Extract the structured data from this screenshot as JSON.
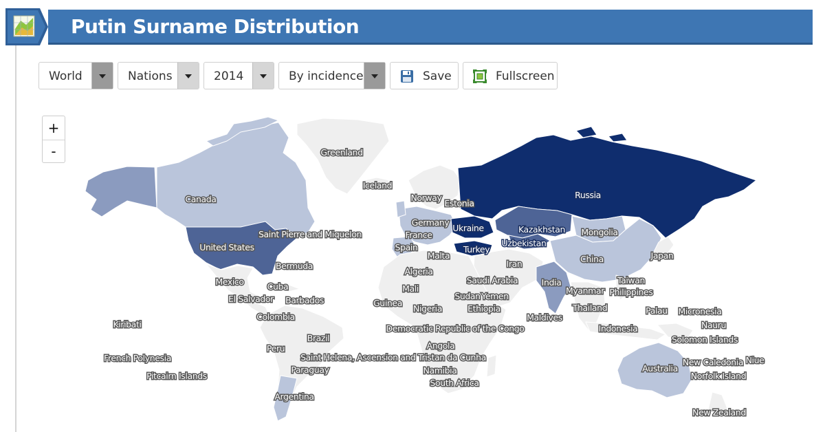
{
  "header": {
    "title": "Putin Surname Distribution",
    "icon": "map-chart-icon"
  },
  "toolbar": {
    "region": "World",
    "level": "Nations",
    "year": "2014",
    "metric": "By incidence",
    "save_label": "Save",
    "save_icon": "floppy-disk-icon",
    "fullscreen_label": "Fullscreen",
    "fullscreen_icon": "fullscreen-icon"
  },
  "zoom": {
    "in_label": "+",
    "out_label": "-"
  },
  "colors": {
    "highest": "#0f2d6e",
    "high": "#4e6496",
    "medium": "#8b9bbf",
    "low": "#bac5db",
    "none": "#efefef",
    "banner": "#3e76b3"
  },
  "map": {
    "countries": [
      "Russia",
      "Canada",
      "United States",
      "Greenland",
      "Iceland",
      "Norway",
      "Estonia",
      "Germany",
      "France",
      "Ukraine",
      "Kazakhstan",
      "Uzbekistan",
      "Mongolia",
      "Spain",
      "Malta",
      "Turkey",
      "Saint Pierre and Miquelon",
      "Bermuda",
      "Mexico",
      "Cuba",
      "El Salvador",
      "Barbados",
      "Colombia",
      "Algeria",
      "Iran",
      "Japan",
      "China",
      "Taiwan",
      "Saudi Arabia",
      "India",
      "Mali",
      "Sudan",
      "Yemen",
      "Myanmar",
      "Philippines",
      "Guinea",
      "Nigeria",
      "Ethiopia",
      "Thailand",
      "Palau",
      "Micronesia",
      "Kiribati",
      "Maldives",
      "Nauru",
      "Democratic Republic of the Congo",
      "Indonesia",
      "Brazil",
      "Solomon Islands",
      "Peru",
      "Angola",
      "French Polynesia",
      "Saint Helena, Ascension and Tristan da Cunha",
      "Niue",
      "New Caledonia",
      "Namibia",
      "Australia",
      "Paraguay",
      "Norfolk Island",
      "Pitcairn Islands",
      "South Africa",
      "Argentina",
      "New Zealand"
    ]
  }
}
